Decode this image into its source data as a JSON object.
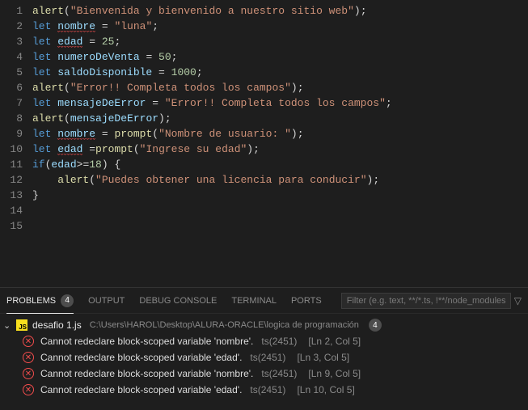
{
  "code": {
    "lines": [
      [
        {
          "cls": "tk-fn",
          "t": "alert"
        },
        {
          "cls": "tk-pun",
          "t": "("
        },
        {
          "cls": "tk-str",
          "t": "\"Bienvenida y bienvenido a nuestro sitio web\""
        },
        {
          "cls": "tk-pun",
          "t": ")"
        },
        {
          "cls": "tk-pun",
          "t": ";"
        }
      ],
      [
        {
          "cls": "tk-kw",
          "t": "let "
        },
        {
          "cls": "tk-var squig",
          "t": "nombre"
        },
        {
          "cls": "tk-op",
          "t": " = "
        },
        {
          "cls": "tk-str",
          "t": "\"luna\""
        },
        {
          "cls": "tk-pun",
          "t": ";"
        }
      ],
      [
        {
          "cls": "tk-kw",
          "t": "let "
        },
        {
          "cls": "tk-var squig",
          "t": "edad"
        },
        {
          "cls": "tk-op",
          "t": " = "
        },
        {
          "cls": "tk-num",
          "t": "25"
        },
        {
          "cls": "tk-pun",
          "t": ";"
        }
      ],
      [
        {
          "cls": "tk-kw",
          "t": "let "
        },
        {
          "cls": "tk-var",
          "t": "numeroDeVenta"
        },
        {
          "cls": "tk-op",
          "t": " = "
        },
        {
          "cls": "tk-num",
          "t": "50"
        },
        {
          "cls": "tk-pun",
          "t": ";"
        }
      ],
      [
        {
          "cls": "tk-kw",
          "t": "let "
        },
        {
          "cls": "tk-var",
          "t": "saldoDisponible"
        },
        {
          "cls": "tk-op",
          "t": " = "
        },
        {
          "cls": "tk-num",
          "t": "1000"
        },
        {
          "cls": "tk-pun",
          "t": ";"
        }
      ],
      [
        {
          "cls": "tk-fn",
          "t": "alert"
        },
        {
          "cls": "tk-pun",
          "t": "("
        },
        {
          "cls": "tk-str",
          "t": "\"Error!! Completa todos los campos\""
        },
        {
          "cls": "tk-pun",
          "t": ")"
        },
        {
          "cls": "tk-pun",
          "t": ";"
        }
      ],
      [
        {
          "cls": "tk-kw",
          "t": "let "
        },
        {
          "cls": "tk-var",
          "t": "mensajeDeError"
        },
        {
          "cls": "tk-op",
          "t": " = "
        },
        {
          "cls": "tk-str",
          "t": "\"Error!! Completa todos los campos\""
        },
        {
          "cls": "tk-pun",
          "t": ";"
        }
      ],
      [
        {
          "cls": "tk-fn",
          "t": "alert"
        },
        {
          "cls": "tk-pun",
          "t": "("
        },
        {
          "cls": "tk-var",
          "t": "mensajeDeError"
        },
        {
          "cls": "tk-pun",
          "t": ")"
        },
        {
          "cls": "tk-pun",
          "t": ";"
        }
      ],
      [
        {
          "cls": "tk-kw",
          "t": "let "
        },
        {
          "cls": "tk-var squig",
          "t": "nombre"
        },
        {
          "cls": "tk-op",
          "t": " = "
        },
        {
          "cls": "tk-fn",
          "t": "prompt"
        },
        {
          "cls": "tk-pun",
          "t": "("
        },
        {
          "cls": "tk-str",
          "t": "\"Nombre de usuario: \""
        },
        {
          "cls": "tk-pun",
          "t": ")"
        },
        {
          "cls": "tk-pun",
          "t": ";"
        }
      ],
      [
        {
          "cls": "tk-kw",
          "t": "let "
        },
        {
          "cls": "tk-var squig",
          "t": "edad"
        },
        {
          "cls": "tk-op",
          "t": " ="
        },
        {
          "cls": "tk-fn",
          "t": "prompt"
        },
        {
          "cls": "tk-pun",
          "t": "("
        },
        {
          "cls": "tk-str",
          "t": "\"Ingrese su edad\""
        },
        {
          "cls": "tk-pun",
          "t": ")"
        },
        {
          "cls": "tk-pun",
          "t": ";"
        }
      ],
      [
        {
          "cls": "tk-kw",
          "t": "if"
        },
        {
          "cls": "tk-pun",
          "t": "("
        },
        {
          "cls": "tk-var",
          "t": "edad"
        },
        {
          "cls": "tk-op",
          "t": ">="
        },
        {
          "cls": "tk-num",
          "t": "18"
        },
        {
          "cls": "tk-pun",
          "t": ")"
        },
        {
          "cls": "tk-pun",
          "t": " {"
        }
      ],
      [
        {
          "cls": "indent-guide",
          "t": "    "
        },
        {
          "cls": "tk-fn",
          "t": "alert"
        },
        {
          "cls": "tk-pun",
          "t": "("
        },
        {
          "cls": "tk-str",
          "t": "\"Puedes obtener una licencia para conducir\""
        },
        {
          "cls": "tk-pun",
          "t": ")"
        },
        {
          "cls": "tk-pun",
          "t": ";"
        }
      ],
      [
        {
          "cls": "tk-pun",
          "t": "}"
        }
      ],
      [],
      []
    ],
    "lineCount": 15
  },
  "panel": {
    "tabs": {
      "problems": "PROBLEMS",
      "problemsBadge": "4",
      "output": "OUTPUT",
      "debug": "DEBUG CONSOLE",
      "terminal": "TERMINAL",
      "ports": "PORTS"
    },
    "filterPlaceholder": "Filter (e.g. text, **/*.ts, !**/node_modules...",
    "file": {
      "icon": "JS",
      "name": "desafio 1.js",
      "path": "C:\\Users\\HAROL\\Desktop\\ALURA-ORACLE\\logica de programación",
      "badge": "4"
    },
    "errors": [
      {
        "msg": "Cannot redeclare block-scoped variable 'nombre'.",
        "code": "ts(2451)",
        "loc": "[Ln 2, Col 5]"
      },
      {
        "msg": "Cannot redeclare block-scoped variable 'edad'.",
        "code": "ts(2451)",
        "loc": "[Ln 3, Col 5]"
      },
      {
        "msg": "Cannot redeclare block-scoped variable 'nombre'.",
        "code": "ts(2451)",
        "loc": "[Ln 9, Col 5]"
      },
      {
        "msg": "Cannot redeclare block-scoped variable 'edad'.",
        "code": "ts(2451)",
        "loc": "[Ln 10, Col 5]"
      }
    ]
  }
}
